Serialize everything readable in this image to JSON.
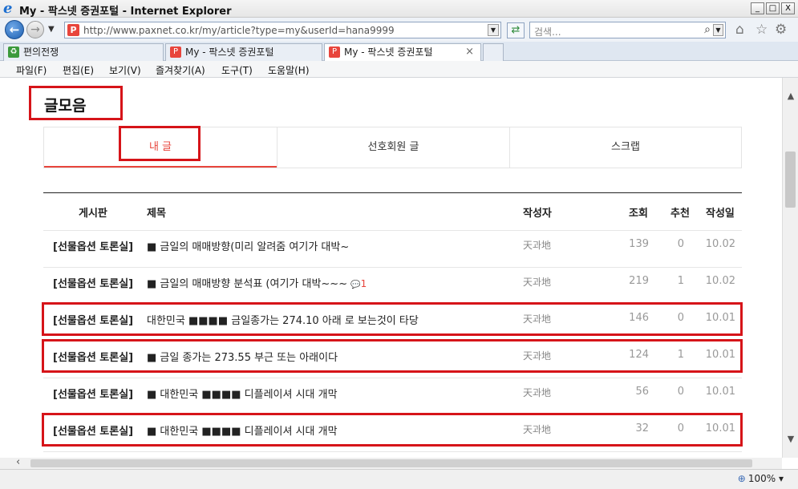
{
  "window": {
    "title": "My - 팍스넷 증권포털 - Internet Explorer",
    "controls": [
      "_",
      "□",
      "X"
    ]
  },
  "address_bar": {
    "url": "http://www.paxnet.co.kr/my/article?type=my&userId=hana9999",
    "site_icon": "P",
    "search_placeholder": "검색..."
  },
  "browser_tabs": [
    {
      "label": "편의전쟁",
      "active": false
    },
    {
      "label": "My - 팍스넷 증권포털",
      "active": false
    },
    {
      "label": "My - 팍스넷 증권포털",
      "active": true
    }
  ],
  "menu": [
    "파일(F)",
    "편집(E)",
    "보기(V)",
    "즐겨찾기(A)",
    "도구(T)",
    "도움말(H)"
  ],
  "page": {
    "title": "글모음",
    "subtabs": [
      {
        "label": "내 글",
        "active": true
      },
      {
        "label": "선호회원 글",
        "active": false
      },
      {
        "label": "스크랩",
        "active": false
      }
    ],
    "columns": {
      "board": "게시판",
      "title": "제목",
      "author": "작성자",
      "views": "조회",
      "recommend": "추천",
      "date": "작성일"
    },
    "rows": [
      {
        "board": "[선물옵션 토론실]",
        "title": "■ 금일의 매매방향(미리 알려줌 여기가 대박~",
        "comments": "",
        "author": "天과地",
        "views": "139",
        "recommend": "0",
        "date": "10.02",
        "highlighted": false
      },
      {
        "board": "[선물옵션 토론실]",
        "title": "■ 금일의 매매방향 분석표 (여기가 대박~~~",
        "comments": "1",
        "author": "天과地",
        "views": "219",
        "recommend": "1",
        "date": "10.02",
        "highlighted": false
      },
      {
        "board": "[선물옵션 토론실]",
        "title": "대한민국 ■■■■ 금일종가는 274.10 아래 로 보는것이 타당",
        "comments": "",
        "author": "天과地",
        "views": "146",
        "recommend": "0",
        "date": "10.01",
        "highlighted": true
      },
      {
        "board": "[선물옵션 토론실]",
        "title": "■ 금일 종가는 273.55 부근 또는 아래이다",
        "comments": "",
        "author": "天과地",
        "views": "124",
        "recommend": "1",
        "date": "10.01",
        "highlighted": true
      },
      {
        "board": "[선물옵션 토론실]",
        "title": "■ 대한민국 ■■■■ 디플레이셔 시대 개막",
        "comments": "",
        "author": "天과地",
        "views": "56",
        "recommend": "0",
        "date": "10.01",
        "highlighted": false
      },
      {
        "board": "[선물옵션 토론실]",
        "title": "■ 대한민국 ■■■■ 디플레이셔 시대 개막",
        "comments": "",
        "author": "天과地",
        "views": "32",
        "recommend": "0",
        "date": "10.01",
        "highlighted": true
      }
    ]
  },
  "status": {
    "zoom": "100%"
  },
  "colors": {
    "accent": "#e8453c",
    "highlight_box": "#d61419"
  }
}
